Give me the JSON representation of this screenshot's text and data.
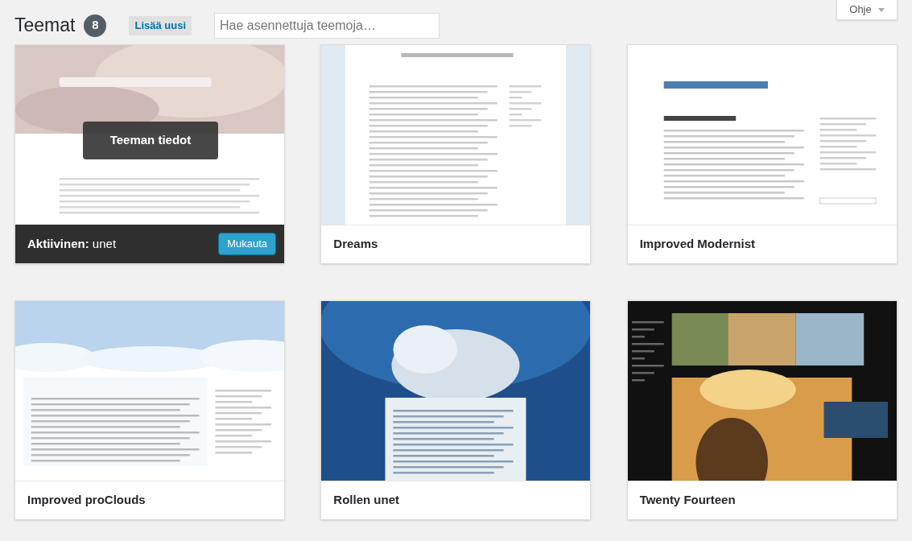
{
  "header": {
    "title": "Teemat",
    "count": "8",
    "add_button": "Lisää uusi",
    "search": {
      "placeholder": "Hae asennettuja teemoja…"
    },
    "help_tab": "Ohje"
  },
  "themes": [
    {
      "active": true,
      "active_label": "**Aktiivinen:** unet",
      "details_button": "Teeman tiedot",
      "customize_button": "Mukauta"
    },
    {
      "active": false,
      "name": "Dreams"
    },
    {
      "active": false,
      "name": "Improved Modernist"
    },
    {
      "active": false,
      "name": "Improved proClouds"
    },
    {
      "active": false,
      "name": "Rollen unet"
    },
    {
      "active": false,
      "name": "Twenty Fourteen"
    }
  ]
}
